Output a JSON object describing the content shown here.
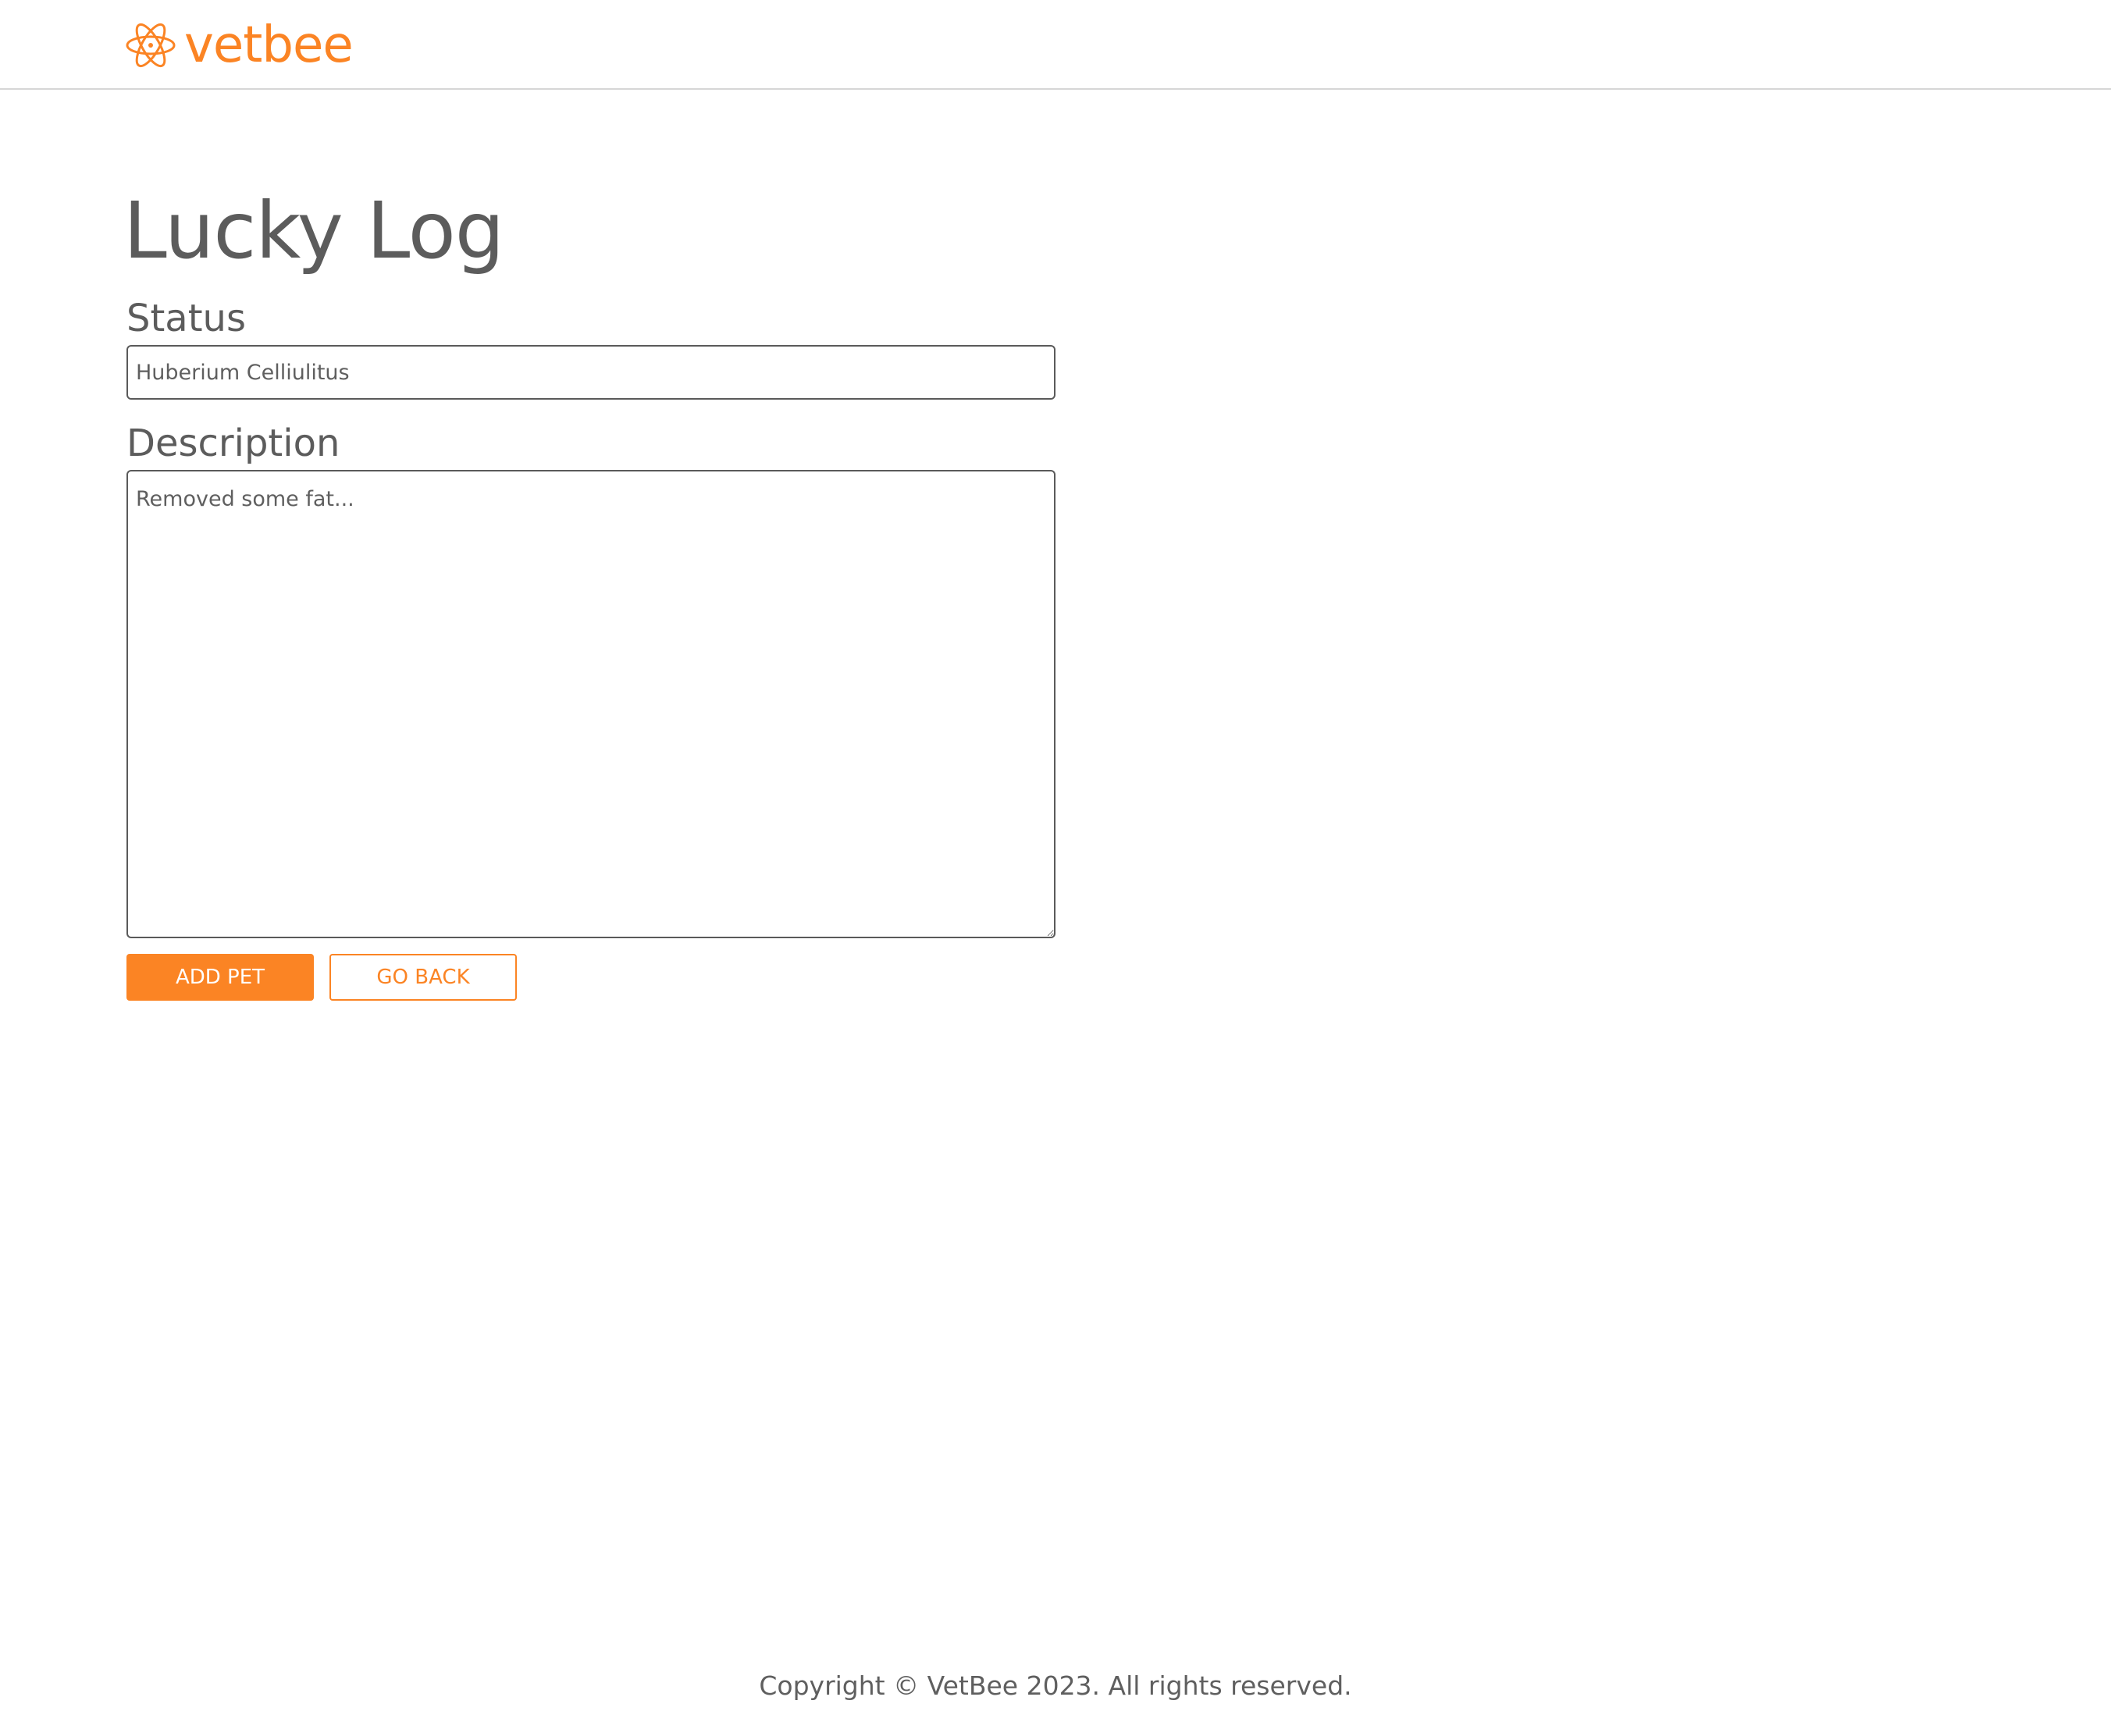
{
  "header": {
    "logo_text": "vetbee",
    "logo_icon": "atom-pet-icon",
    "brand_color": "#fb8424"
  },
  "main": {
    "title": "Lucky Log",
    "status": {
      "label": "Status",
      "placeholder": "Huberium Celliulitus",
      "value": ""
    },
    "description": {
      "label": "Description",
      "placeholder": "Removed some fat...",
      "value": ""
    },
    "buttons": {
      "submit_label": "ADD PET",
      "back_label": "GO BACK"
    }
  },
  "footer": {
    "copyright": "Copyright © VetBee 2023. All rights reserved."
  }
}
